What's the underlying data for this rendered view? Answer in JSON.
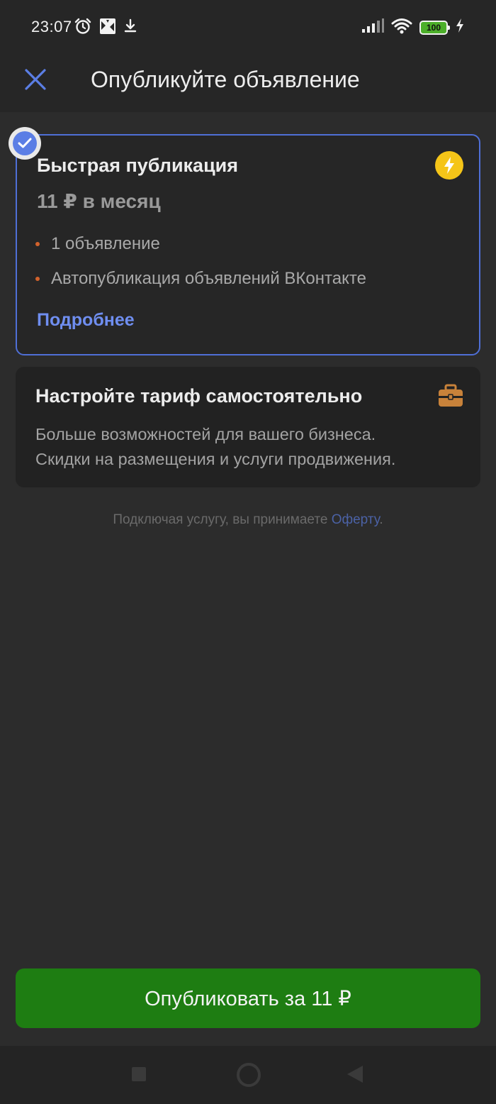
{
  "status_bar": {
    "time": "23:07",
    "battery_level": "100",
    "icons_left": [
      "alarm-icon",
      "gallery-icon",
      "download-icon"
    ],
    "icons_right": [
      "signal-icon",
      "wifi-icon",
      "battery-icon",
      "charging-icon"
    ]
  },
  "header": {
    "title": "Опубликуйте объявление",
    "close_icon": "close-icon"
  },
  "plans": {
    "fast": {
      "title": "Быстрая публикация",
      "price": "11 ₽ в месяц",
      "features": [
        "1 объявление",
        "Автопубликация объявлений ВКонтакте"
      ],
      "more_label": "Подробнее",
      "selected": true,
      "icon": "lightning-icon"
    },
    "custom": {
      "title": "Настройте тариф самостоятельно",
      "description_line1": "Больше возможностей для вашего бизнеса.",
      "description_line2": "Скидки на размещения и услуги продвижения.",
      "icon": "briefcase-icon"
    }
  },
  "offer": {
    "text": "Подключая услугу, вы принимаете ",
    "link": "Оферту",
    "suffix": "."
  },
  "publish_button": {
    "label": "Опубликовать за 11 ₽"
  },
  "colors": {
    "accent_blue": "#5b7ee5",
    "link_blue": "#6f8ef0",
    "button_green": "#1e7d12",
    "bullet_orange": "#d2622c",
    "lightning_yellow": "#f5c518",
    "briefcase_orange": "#c8823a"
  }
}
